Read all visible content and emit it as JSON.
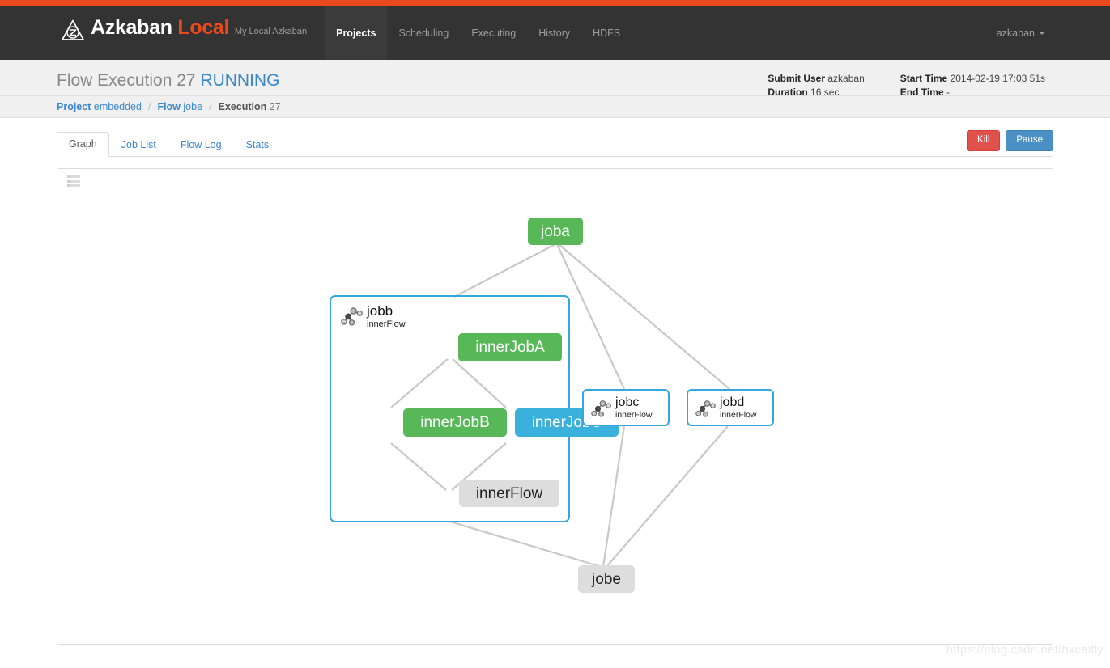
{
  "theme": {
    "accent_bar": "#e8491d",
    "navbar_bg": "#333333",
    "brand_accent": "#e8491d",
    "link_blue": "#3a87cd",
    "status_running_color": "#3a87cd",
    "node_success": "#58b858",
    "node_running": "#3ab0dd",
    "node_ready": "#dddddd",
    "flow_border": "#35a7dd",
    "edge_color": "#c8c8c8"
  },
  "navbar": {
    "logo_icon": "azkaban-triangle-logo-icon",
    "brand_name": "Azkaban",
    "brand_suffix": "Local",
    "brand_tagline": "My Local Azkaban",
    "items": [
      {
        "label": "Projects",
        "active": true
      },
      {
        "label": "Scheduling",
        "active": false
      },
      {
        "label": "Executing",
        "active": false
      },
      {
        "label": "History",
        "active": false
      },
      {
        "label": "HDFS",
        "active": false
      }
    ],
    "user": "azkaban",
    "user_caret_icon": "chevron-down-icon"
  },
  "page_header": {
    "title_prefix": "Flow Execution 27",
    "status": "RUNNING",
    "meta": {
      "submit_user_label": "Submit User",
      "submit_user_value": "azkaban",
      "duration_label": "Duration",
      "duration_value": "16 sec",
      "start_time_label": "Start Time",
      "start_time_value": "2014-02-19 17:03 51s",
      "end_time_label": "End Time",
      "end_time_value": "-"
    }
  },
  "breadcrumb": {
    "project_label": "Project",
    "project_value": "embedded",
    "flow_label": "Flow",
    "flow_value": "jobe",
    "execution_label": "Execution",
    "execution_value": "27",
    "separator": "/"
  },
  "tabs": [
    {
      "label": "Graph",
      "active": true
    },
    {
      "label": "Job List",
      "active": false
    },
    {
      "label": "Flow Log",
      "active": false
    },
    {
      "label": "Stats",
      "active": false
    }
  ],
  "actions": {
    "kill_label": "Kill",
    "pause_label": "Pause"
  },
  "graph": {
    "toggle_icon": "list-view-icon",
    "nodes": [
      {
        "id": "joba",
        "label": "joba",
        "type": "job",
        "state": "green"
      },
      {
        "id": "jobb",
        "label": "jobb",
        "sub": "innerFlow",
        "type": "embedded-flow-expanded",
        "state": "flow"
      },
      {
        "id": "innerJobA",
        "label": "innerJobA",
        "type": "job",
        "state": "green"
      },
      {
        "id": "innerJobB",
        "label": "innerJobB",
        "type": "job",
        "state": "green"
      },
      {
        "id": "innerJobC",
        "label": "innerJobC",
        "type": "job",
        "state": "blue"
      },
      {
        "id": "innerFlow",
        "label": "innerFlow",
        "type": "job",
        "state": "gray"
      },
      {
        "id": "jobc",
        "label": "jobc",
        "sub": "innerFlow",
        "type": "embedded-flow-collapsed",
        "state": "flow"
      },
      {
        "id": "jobd",
        "label": "jobd",
        "sub": "innerFlow",
        "type": "embedded-flow-collapsed",
        "state": "flow"
      },
      {
        "id": "jobe",
        "label": "jobe",
        "type": "job",
        "state": "gray"
      }
    ],
    "flow_icon": "flow-tree-icon",
    "watermark": "https://blog.csdn.net/hxcaifly"
  }
}
